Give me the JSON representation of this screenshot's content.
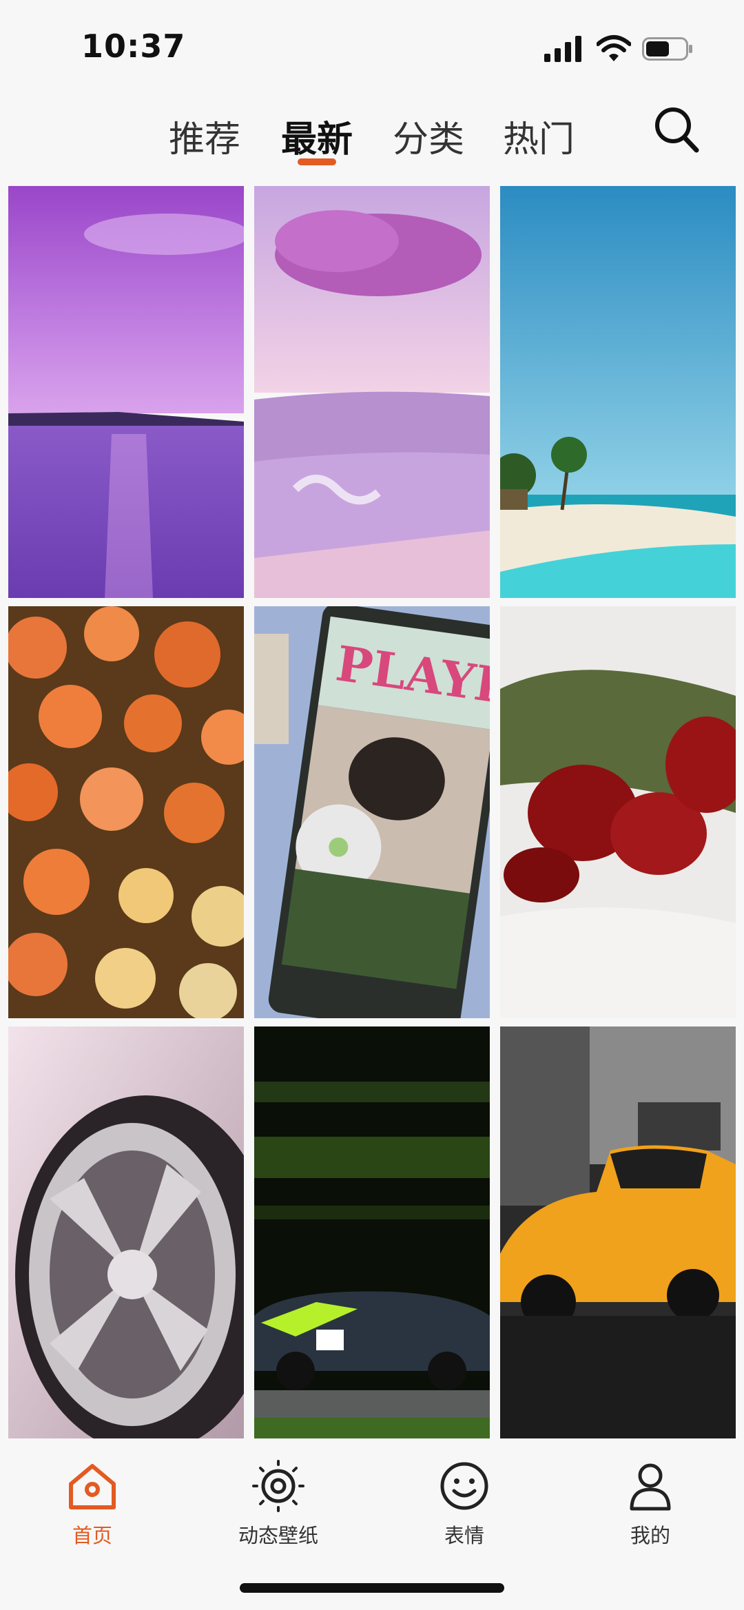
{
  "status_bar": {
    "time": "10:37",
    "battery_level": 0.6
  },
  "top_nav": {
    "tabs": [
      {
        "label": "推荐",
        "active": false
      },
      {
        "label": "最新",
        "active": true
      },
      {
        "label": "分类",
        "active": false
      },
      {
        "label": "热门",
        "active": false
      }
    ],
    "search_icon": "search-icon"
  },
  "wallpapers": [
    {
      "subject": "purple-sunset-sea"
    },
    {
      "subject": "pink-clouds-lavender-field"
    },
    {
      "subject": "tropical-beach-palms"
    },
    {
      "subject": "orange-roses-bouquet"
    },
    {
      "subject": "playlist-magazine-cd"
    },
    {
      "subject": "red-roses-white-sheet"
    },
    {
      "subject": "car-wheel-closeup"
    },
    {
      "subject": "green-race-car-motion"
    },
    {
      "subject": "yellow-beetle-car"
    }
  ],
  "bottom_nav": {
    "items": [
      {
        "label": "首页",
        "icon": "home-icon",
        "active": true
      },
      {
        "label": "动态壁纸",
        "icon": "live-wallpaper-icon",
        "active": false
      },
      {
        "label": "表情",
        "icon": "smiley-icon",
        "active": false
      },
      {
        "label": "我的",
        "icon": "profile-icon",
        "active": false
      }
    ]
  },
  "colors": {
    "accent": "#e35a22",
    "text": "#333333",
    "background": "#f7f7f7"
  }
}
